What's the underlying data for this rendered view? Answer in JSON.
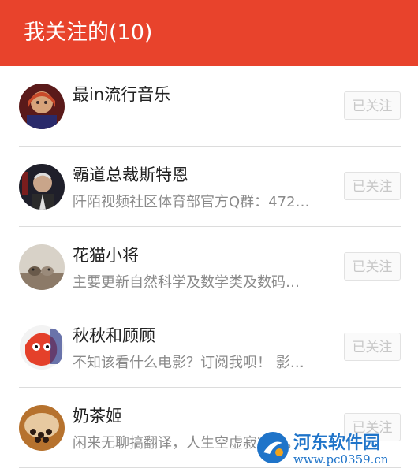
{
  "header": {
    "title": "我关注的(10)"
  },
  "list": [
    {
      "name": "最in流行音乐",
      "desc": "",
      "button": "已关注"
    },
    {
      "name": "霸道总裁斯特恩",
      "desc": "阡陌视频社区体育部官方Q群：472…",
      "button": "已关注"
    },
    {
      "name": "花猫小将",
      "desc": "主要更新自然科学及数学类及数码…",
      "button": "已关注"
    },
    {
      "name": "秋秋和顾顾",
      "desc": "不知该看什么电影？订阅我呗！ 影…",
      "button": "已关注"
    },
    {
      "name": "奶茶姬",
      "desc": "闲来无聊搞翻译，人生空虚寂寞多。",
      "button": "已关注"
    }
  ],
  "watermark": {
    "name": "河东软件园",
    "url": "www.pc0359.cn"
  },
  "colors": {
    "header": "#e8432c",
    "watermark": "#1f74c9"
  }
}
